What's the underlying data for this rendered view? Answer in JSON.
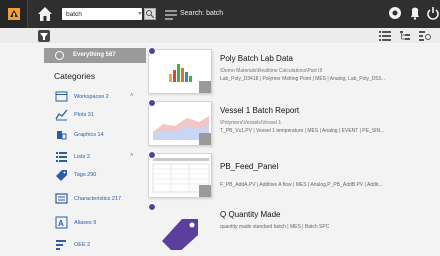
{
  "topbar": {
    "search_value": "batch",
    "title": "Search: batch",
    "app_icon": "app-logo-icon",
    "home_icon": "home-icon",
    "right_icons": [
      "help-icon",
      "notification-icon",
      "power-icon"
    ]
  },
  "toolbar": {
    "filter_icon": "filter-icon",
    "view_icons": [
      "list-view-icon",
      "tree-view-icon",
      "settings-view-icon"
    ]
  },
  "sidebar": {
    "all_label": "Everything 567",
    "categories_title": "Categories",
    "items": [
      {
        "label": "Workspaces 2",
        "icon": "workspace-icon",
        "expandable": true
      },
      {
        "label": "Plots 31",
        "icon": "plot-icon",
        "expandable": false
      },
      {
        "label": "Graphics 14",
        "icon": "graphics-icon",
        "expandable": false
      },
      {
        "label": "Lists 2",
        "icon": "list-icon",
        "expandable": true
      },
      {
        "label": "Tags 290",
        "icon": "tag-icon",
        "expandable": false
      },
      {
        "label": "Characteristics 217",
        "icon": "characteristics-icon",
        "expandable": false
      },
      {
        "label": "Aliases 9",
        "icon": "alias-icon",
        "expandable": false
      },
      {
        "label": "OEE 2",
        "icon": "oee-icon",
        "expandable": false
      }
    ]
  },
  "results": [
    {
      "title": "Poly Batch Lab Data",
      "path": "\\Demo Materials\\Realtime Calculations\\Part III",
      "meta": "Lab_Poly_D3418 | Polymer Melting Point | MES | Analog, Lab_Poly_D53..."
    },
    {
      "title": "Vessel 1 Batch Report",
      "path": "\\Polymers\\Vessels\\Vessel 1",
      "meta": "T_PB_Vs1.PV | Vessel 1 temperature | MES | Analog | EVENT | PE_SIN..."
    },
    {
      "title": "PB_Feed_Panel",
      "path": "",
      "meta": "F_PB_AddA.PV | Additive A flow | MES | Analog,P_PB_AddB.PV | Addit..."
    },
    {
      "title": "Q Quantity Made",
      "path": "",
      "meta": "quantity made standard batch | MES | Batch SPC"
    }
  ],
  "colors": {
    "topbar": "#2f2f2f",
    "accent_orange": "#f0a030",
    "badge_purple": "#5a3f9e",
    "link_blue": "#2a5ea0"
  }
}
